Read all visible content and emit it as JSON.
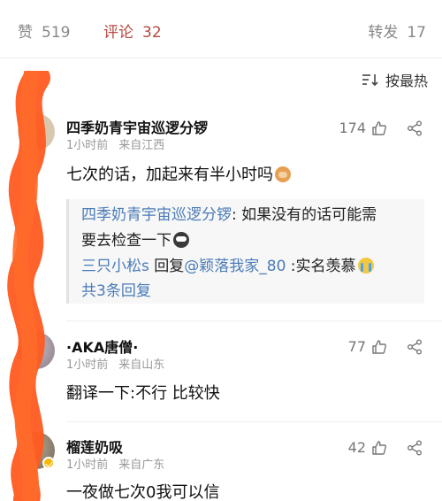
{
  "tabs": {
    "like_label": "赞",
    "like_count": "519",
    "comment_label": "评论",
    "comment_count": "32",
    "repost_label": "转发",
    "repost_count": "17"
  },
  "sort": {
    "label": "按最热",
    "icon": "sort-icon"
  },
  "comments": [
    {
      "username": "四季奶青宇宙巡逻分锣",
      "time": "1小时前",
      "location": "来自江西",
      "text": "七次的话，加起来有半小时吗",
      "emoji": "monkey-emoji",
      "likes": "174",
      "replies": {
        "r1_user": "四季奶青宇宙巡逻分锣",
        "r1_text_a": ": 如果没有的话可能需",
        "r1_text_b": "要去检查一下",
        "r1_emoji": "mask-emoji",
        "r2_user": "三只小松s",
        "r2_mid": " 回复",
        "r2_target": "@颖落我家_80",
        "r2_text": " :实名羡慕",
        "r2_emoji": "cry-emoji",
        "count_label": "共3条回复"
      }
    },
    {
      "username": "·AKA唐僧·",
      "time": "1小时前",
      "location": "来自山东",
      "text": "翻译一下:不行 比较快",
      "likes": "77"
    },
    {
      "username": "榴莲奶吸",
      "time": "1小时前",
      "location": "来自广东",
      "text": "一夜做七次0我可以信",
      "likes": "42"
    }
  ],
  "colors": {
    "active_tab": "#b5473f",
    "link_blue": "#4a7bb7",
    "scribble_orange": "#ff5a1f",
    "muted": "#999999"
  }
}
